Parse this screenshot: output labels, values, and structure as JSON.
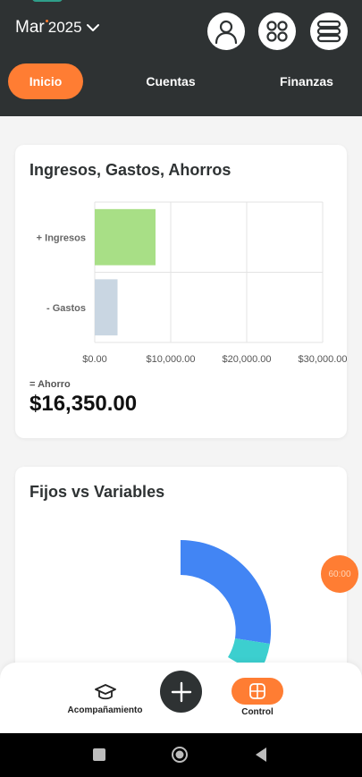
{
  "header": {
    "month": "Mar",
    "year": "2025",
    "tabs": [
      {
        "label": "Inicio",
        "active": true
      },
      {
        "label": "Cuentas",
        "active": false
      },
      {
        "label": "Finanzas",
        "active": false
      }
    ],
    "icons": [
      "user-icon",
      "apps-grid-icon",
      "stack-menu-icon"
    ]
  },
  "card1": {
    "title": "Ingresos, Gastos, Ahorros",
    "ahorro_label": "= Ahorro",
    "ahorro_value": "$16,350.00"
  },
  "chart_data": {
    "type": "bar",
    "orientation": "horizontal",
    "categories": [
      "+ Ingresos",
      "- Gastos"
    ],
    "values": [
      8000,
      3000
    ],
    "colors": [
      "#a8df86",
      "#c9d6e2"
    ],
    "xlim": [
      0,
      30000
    ],
    "xticks": [
      "$0.00",
      "$10,000.00",
      "$20,000.00",
      "$30,000.00"
    ],
    "grid": true
  },
  "card2": {
    "title": "Fijos vs Variables",
    "donut_colors": [
      "#4285f4",
      "#3ccfcf"
    ]
  },
  "timer": "60:00",
  "bottom": {
    "accompaniment_label": "Acompañamiento",
    "control_label": "Control"
  },
  "colors": {
    "accent": "#ff7d33",
    "header_bg": "#2e3233"
  }
}
